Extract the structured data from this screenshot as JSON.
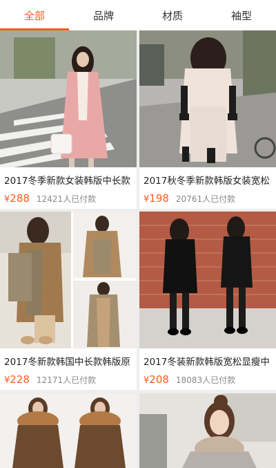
{
  "tabs": [
    {
      "label": "全部",
      "active": true
    },
    {
      "label": "品牌",
      "active": false
    },
    {
      "label": "材质",
      "active": false
    },
    {
      "label": "袖型",
      "active": false
    }
  ],
  "currency": "¥",
  "products": [
    {
      "title": "2017冬季新款女装韩版中长款",
      "price": "288",
      "sold": "12421人已付款"
    },
    {
      "title": "2017秋冬季新款韩版女装宽松",
      "price": "198",
      "sold": "20761人已付款"
    },
    {
      "title": "2017冬新款韩国中长款韩版原",
      "price": "228",
      "sold": "12171人已付款"
    },
    {
      "title": "2017冬装新款韩版宽松显瘦中",
      "price": "208",
      "sold": "18083人已付款"
    }
  ],
  "colors": {
    "accent": "#ff5a1f",
    "background": "#eeeeee"
  }
}
